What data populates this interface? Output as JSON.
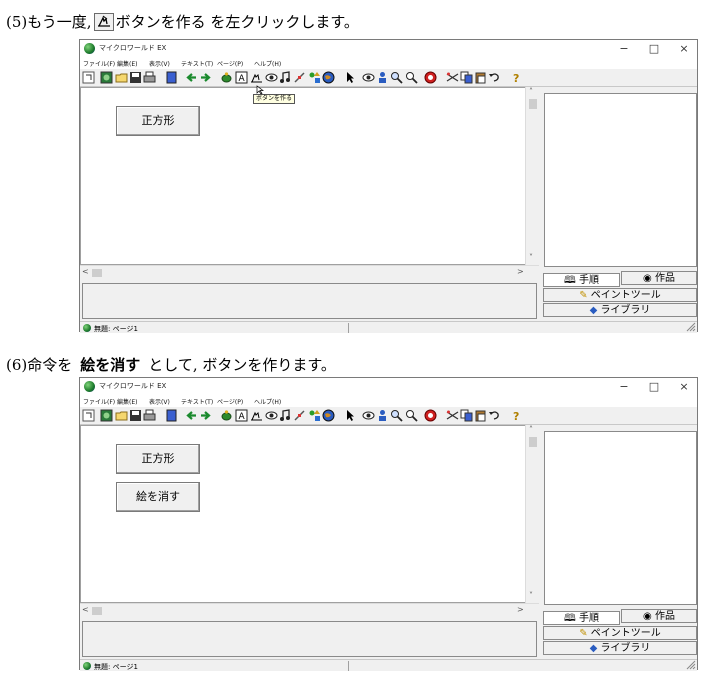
{
  "steps": [
    {
      "num": "(5)",
      "prefix": "もう一度,",
      "suffix": "ボタンを作る を左クリックします。",
      "bold": "",
      "icon": "button-create-icon"
    },
    {
      "num": "(6)",
      "prefix": "命令を",
      "bold": "絵を消す",
      "suffix": "として, ボタンを作ります。"
    }
  ],
  "window": {
    "title": "マイクロワールド EX",
    "controls": {
      "minimize": "−",
      "maximize": "□",
      "close": "×"
    },
    "menu": [
      "ファイル(F)",
      "編集(E)",
      "表示(V)",
      "テキスト(T)",
      "ページ(P)",
      "ヘルプ(H)"
    ],
    "tabs": {
      "procedures": "手順",
      "works": "作品",
      "paint_tool": "ペイントツール",
      "library": "ライブラリ"
    },
    "status": "無題: ページ1"
  },
  "screens": [
    {
      "buttons": [
        "正方形"
      ],
      "tooltip": "ボタンを作る"
    },
    {
      "buttons": [
        "正方形",
        "絵を消す"
      ],
      "tooltip": ""
    }
  ],
  "toolbar_icons": [
    "fold-icon",
    "book-icon",
    "open-icon",
    "save-icon",
    "print-icon",
    "page-icon",
    "prev-page-icon",
    "next-page-icon",
    "turtle-icon",
    "text-box-icon",
    "button-create-icon",
    "eye-icon",
    "music-icon",
    "slider-icon",
    "shapes-icon",
    "globe-icon",
    "pointer-icon",
    "show-icon",
    "stamp-icon",
    "zoom-in-icon",
    "zoom-out-icon",
    "stop-icon",
    "scissors-icon",
    "copy-icon",
    "paste-icon",
    "undo-icon",
    "help-icon"
  ],
  "colors": {
    "window_bg": "#f0f0f0",
    "tooltip_bg": "#ffffe1",
    "border": "#7a7a7a"
  }
}
